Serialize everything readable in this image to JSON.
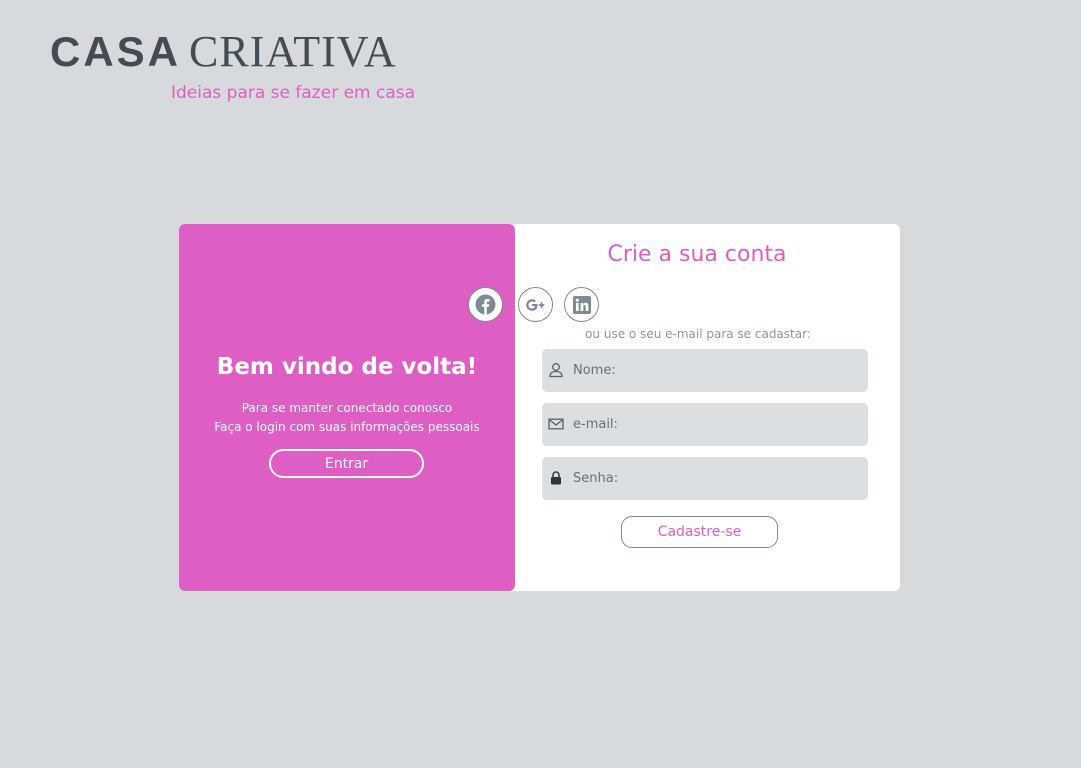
{
  "brand": {
    "name_bold": "CASA",
    "name_light": "CRIATIVA",
    "tagline": "Ideias para se fazer em casa"
  },
  "welcome_panel": {
    "title": "Bem vindo de volta!",
    "line1": "Para se manter conectado conosco",
    "line2": "Faça o login com suas informações pessoais",
    "login_button": "Entrar"
  },
  "signup_panel": {
    "title": "Crie a sua conta",
    "social_icons": [
      "facebook-icon",
      "google-plus-icon",
      "linkedin-icon"
    ],
    "alt_text": "ou use o seu e-mail para se cadastar:",
    "fields": [
      {
        "placeholder": "Nome:",
        "value": "",
        "icon": "user-icon"
      },
      {
        "placeholder": "e-mail:",
        "value": "",
        "icon": "mail-icon"
      },
      {
        "placeholder": "Senha:",
        "value": "",
        "icon": "lock-icon"
      }
    ],
    "signup_button": "Cadastre-se"
  },
  "colors": {
    "background": "#d6dadc",
    "accent": "#df5ec4",
    "brand_dark": "#434c55",
    "field_bg": "#dcdfe2",
    "muted": "#7e8a97"
  }
}
